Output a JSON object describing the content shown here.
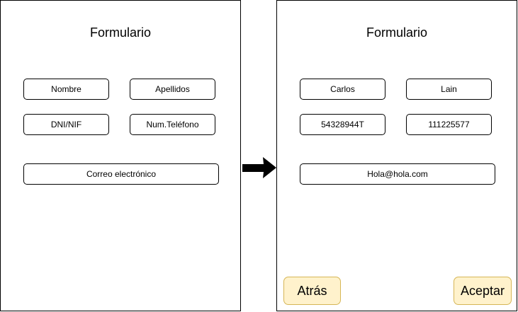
{
  "form_empty": {
    "title": "Formulario",
    "fields": [
      "Nombre",
      "Apellidos",
      "DNI/NIF",
      "Num.Teléfono",
      "Correo electrónico"
    ]
  },
  "form_filled": {
    "title": "Formulario",
    "fields": [
      "Carlos",
      "Lain",
      "54328944T",
      "111225577",
      "Hola@hola.com"
    ],
    "buttons": {
      "back": "Atrás",
      "accept": "Aceptar"
    }
  },
  "colors": {
    "button_fill": "#fff2cc",
    "button_border": "#d6b656",
    "arrow": "#000000"
  }
}
